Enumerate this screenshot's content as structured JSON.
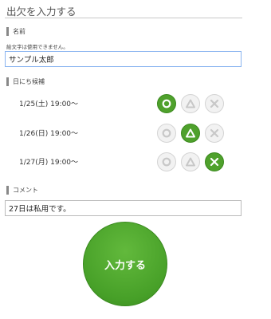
{
  "page": {
    "title": "出欠を入力する"
  },
  "name_section": {
    "label": "名前",
    "hint": "絵文字は使用できません。",
    "value": "サンプル太郎"
  },
  "dates_section": {
    "label": "日にち候補",
    "rows": [
      {
        "label": "1/25(土) 19:00〜",
        "selected": "maru"
      },
      {
        "label": "1/26(日) 19:00〜",
        "selected": "sankaku"
      },
      {
        "label": "1/27(月) 19:00〜",
        "selected": "batsu"
      }
    ],
    "options": [
      "maru",
      "sankaku",
      "batsu"
    ]
  },
  "comment_section": {
    "label": "コメント",
    "value": "27日は私用です。"
  },
  "submit": {
    "label": "入力する"
  },
  "colors": {
    "accent": "#4fa12c",
    "inactive": "#f2f2f2",
    "inactive_icon": "#c8c8c8"
  }
}
